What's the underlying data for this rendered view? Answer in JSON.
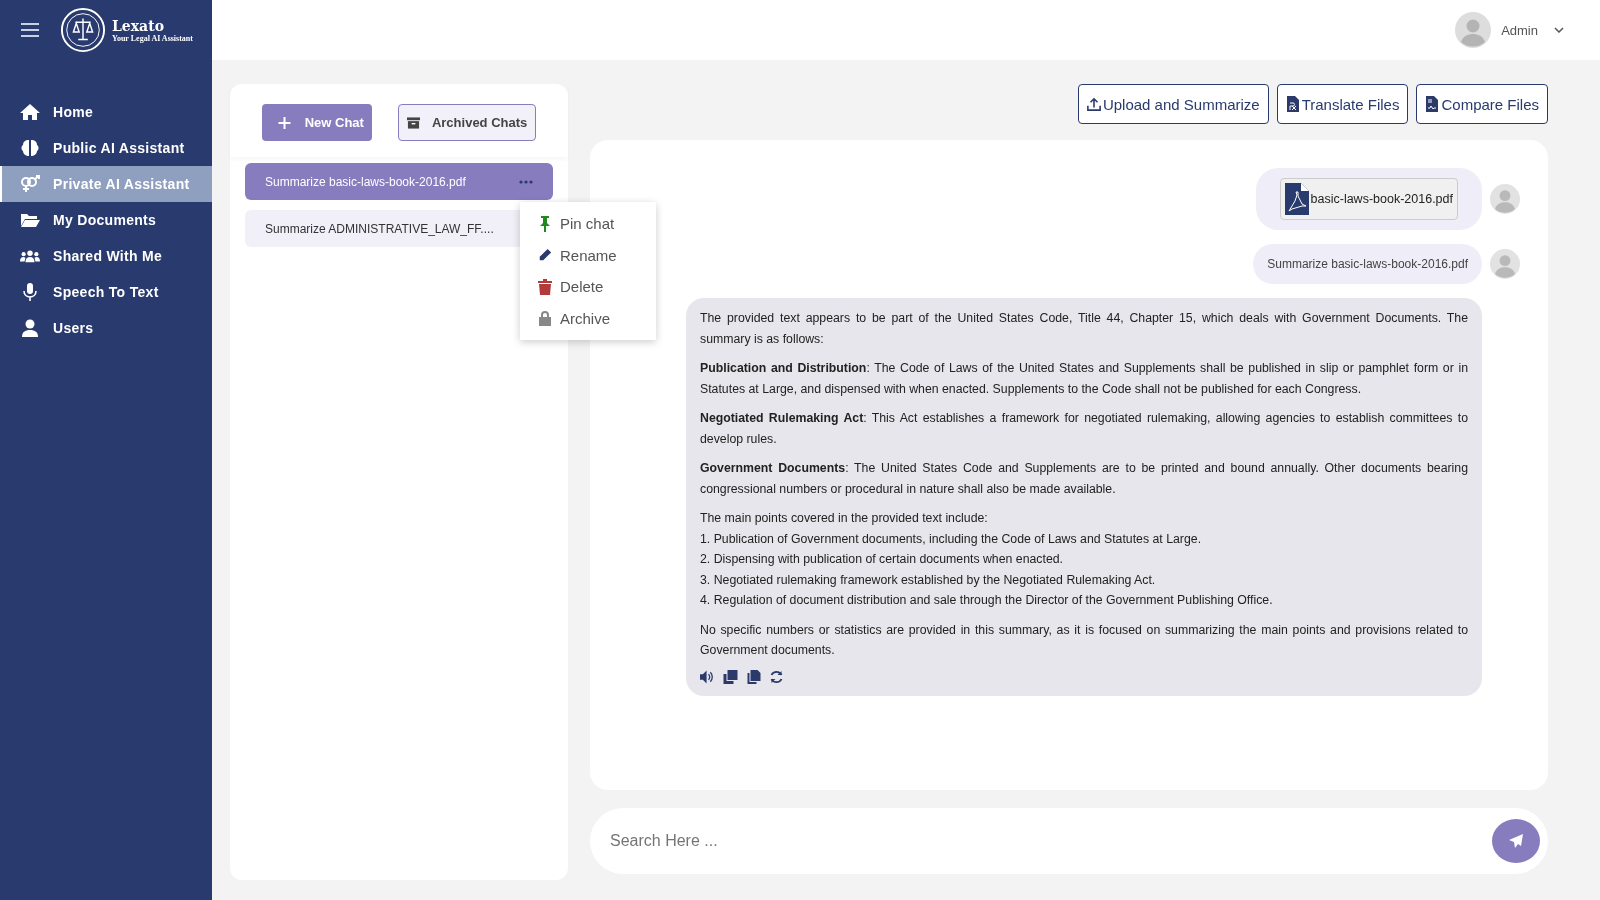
{
  "brand": {
    "name": "Lexato",
    "tagline": "Your Legal AI Assistant"
  },
  "sidebar": {
    "items": [
      {
        "label": "Home",
        "selected": false
      },
      {
        "label": "Public AI Assistant",
        "selected": false
      },
      {
        "label": "Private AI Assistant",
        "selected": true
      },
      {
        "label": "My Documents",
        "selected": false
      },
      {
        "label": "Shared With Me",
        "selected": false
      },
      {
        "label": "Speech To Text",
        "selected": false
      },
      {
        "label": "Users",
        "selected": false
      }
    ]
  },
  "header": {
    "user": "Admin"
  },
  "chats_panel": {
    "new_chat": "New Chat",
    "archived": "Archived Chats",
    "items": [
      {
        "title": "Summarize basic-laws-book-2016.pdf",
        "selected": true
      },
      {
        "title": "Summarize ADMINISTRATIVE_LAW_FF....",
        "selected": false
      }
    ],
    "context_menu": [
      {
        "label": "Pin chat"
      },
      {
        "label": "Rename"
      },
      {
        "label": "Delete"
      },
      {
        "label": "Archive"
      }
    ]
  },
  "toolbar": [
    "Upload and Summarize",
    "Translate Files",
    "Compare Files"
  ],
  "messages": [
    {
      "kind": "file",
      "text": "basic-laws-book-2016.pdf"
    },
    {
      "kind": "user",
      "text": "Summarize basic-laws-book-2016.pdf"
    },
    {
      "kind": "answer",
      "blocks": [
        [
          "The provided text appears to be part of the United States Code, Title 44, Chapter 15, which deals with Government Documents. The summary is as follows:"
        ],
        [
          "**Publication and Distribution**: The Code of Laws of the United States and Supplements shall be published in slip or pamphlet form or in Statutes at Large, and dispensed with when enacted. Supplements to the Code shall not be published for each Congress."
        ],
        [
          "**Negotiated Rulemaking Act**: This Act establishes a framework for negotiated rulemaking, allowing agencies to establish committees to develop rules."
        ],
        [
          "**Government Documents**: The United States Code and Supplements are to be printed and bound annually. Other documents bearing congressional numbers or procedural in nature shall also be made available."
        ],
        [
          "The main points covered in the provided text include:",
          "1. Publication of Government documents, including the Code of Laws and Statutes at Large.",
          "2. Dispensing with publication of certain documents when enacted.",
          "3. Negotiated rulemaking framework established by the Negotiated Rulemaking Act.",
          "4. Regulation of document distribution and sale through the Director of the Government Publishing Office."
        ],
        [
          "No specific numbers or statistics are provided in this summary, as it is focused on summarizing the main points and provisions related to Government documents."
        ]
      ]
    }
  ],
  "search": {
    "placeholder": "Search Here ..."
  }
}
